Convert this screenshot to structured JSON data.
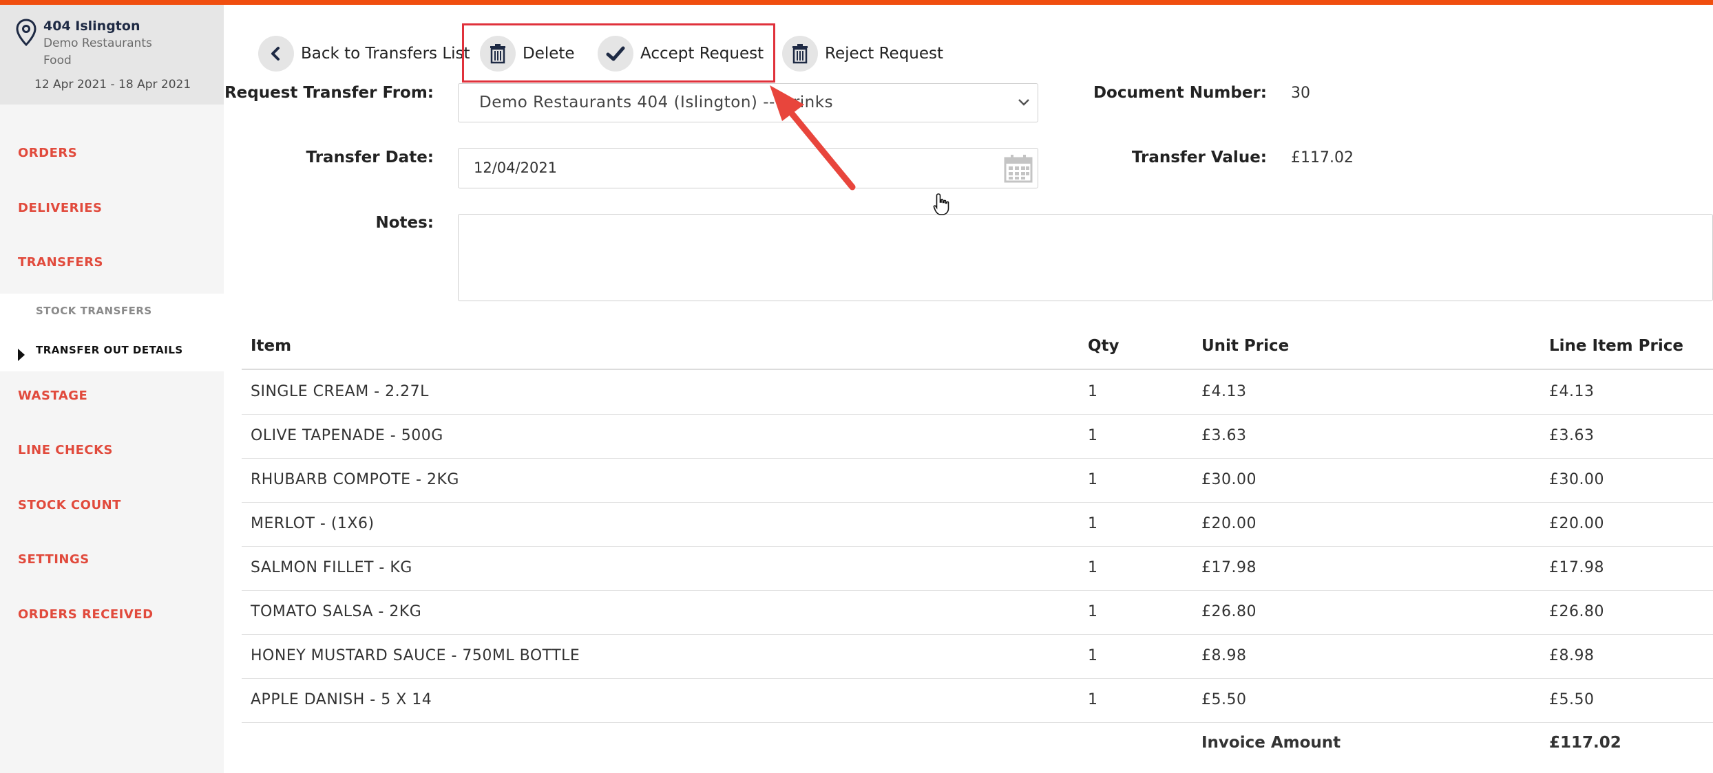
{
  "sidebar": {
    "location_name": "404 Islington",
    "location_sub1": "Demo Restaurants",
    "location_sub2": "Food",
    "date_range": "12 Apr 2021 - 18 Apr 2021",
    "nav": [
      "ORDERS",
      "DELIVERIES",
      "TRANSFERS",
      "WASTAGE",
      "LINE CHECKS",
      "STOCK COUNT",
      "SETTINGS",
      "ORDERS RECEIVED"
    ],
    "sub_items": [
      "STOCK TRANSFERS",
      "TRANSFER OUT DETAILS"
    ]
  },
  "toolbar": {
    "back": "Back to Transfers List",
    "delete": "Delete",
    "accept": "Accept Request",
    "reject": "Reject Request"
  },
  "form": {
    "request_from_label": "Request Transfer From:",
    "request_from_value": "Demo Restaurants 404 (Islington) -- Drinks",
    "transfer_date_label": "Transfer Date:",
    "transfer_date_value": "12/04/2021",
    "notes_label": "Notes:",
    "notes_value": "",
    "document_number_label": "Document Number:",
    "document_number_value": "30",
    "transfer_value_label": "Transfer Value:",
    "transfer_value_value": "£117.02"
  },
  "table": {
    "headers": [
      "Item",
      "Qty",
      "Unit Price",
      "Line Item Price"
    ],
    "rows": [
      [
        "SINGLE CREAM - 2.27L",
        "1",
        "£4.13",
        "£4.13"
      ],
      [
        "OLIVE TAPENADE - 500G",
        "1",
        "£3.63",
        "£3.63"
      ],
      [
        "RHUBARB COMPOTE - 2KG",
        "1",
        "£30.00",
        "£30.00"
      ],
      [
        "MERLOT - (1X6)",
        "1",
        "£20.00",
        "£20.00"
      ],
      [
        "SALMON FILLET - KG",
        "1",
        "£17.98",
        "£17.98"
      ],
      [
        "TOMATO SALSA - 2KG",
        "1",
        "£26.80",
        "£26.80"
      ],
      [
        "HONEY MUSTARD SAUCE - 750ML BOTTLE",
        "1",
        "£8.98",
        "£8.98"
      ],
      [
        "APPLE DANISH - 5 X 14",
        "1",
        "£5.50",
        "£5.50"
      ]
    ],
    "footer_label": "Invoice Amount",
    "footer_value": "£117.02"
  },
  "colors": {
    "accent_orange": "#f04e0f",
    "nav_red": "#e14a3c",
    "highlight_red": "#e0313b",
    "navy": "#1e2a44"
  }
}
